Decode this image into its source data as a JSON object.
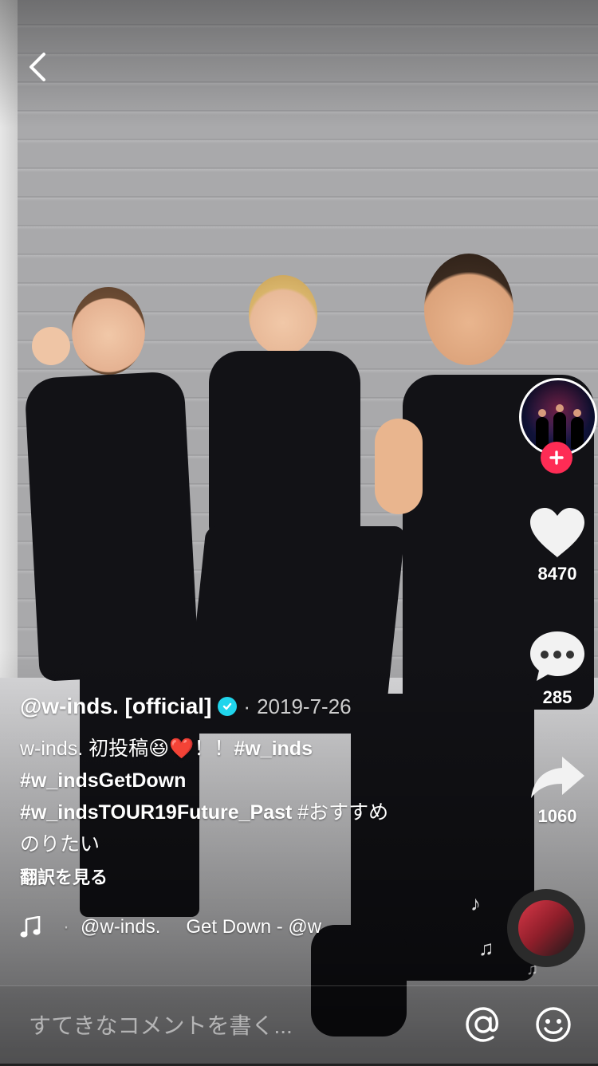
{
  "video": {
    "colors": {
      "wall": "#a9a9ab",
      "floor": "#cfcfd1",
      "outfit": "#121216"
    }
  },
  "top_bar": {
    "back_icon": "chevron-left-icon"
  },
  "creator": {
    "handle": "@w-inds. [official]",
    "verified_icon": "verified-badge-icon",
    "date_prefix": "·",
    "date": "2019-7-26"
  },
  "actions": {
    "follow_icon": "plus-icon",
    "like": {
      "icon": "heart-icon",
      "count": "8470"
    },
    "comment": {
      "icon": "comment-bubble-icon",
      "count": "285"
    },
    "share": {
      "icon": "share-arrow-icon",
      "count": "1060"
    }
  },
  "caption": {
    "line1_text": "w-inds. 初投稿😆❤️！！",
    "line1_tag": "#w_inds",
    "line2_tag": "#w_indsGetDown",
    "line3_tag": "#w_indsTOUR19Future_Past",
    "line3_text": " #おすすめ",
    "line4_text": "のりたい",
    "translate": "翻訳を見る"
  },
  "music": {
    "icon": "music-note-icon",
    "separator": "·",
    "artist": "@w-inds.",
    "title": "Get Down - @w"
  },
  "comment_bar": {
    "placeholder": "すてきなコメントを書く...",
    "mention_icon": "at-icon",
    "emoji_icon": "smiley-icon"
  },
  "accent": {
    "follow": "#fe2c55",
    "verified": "#20d5ec"
  }
}
